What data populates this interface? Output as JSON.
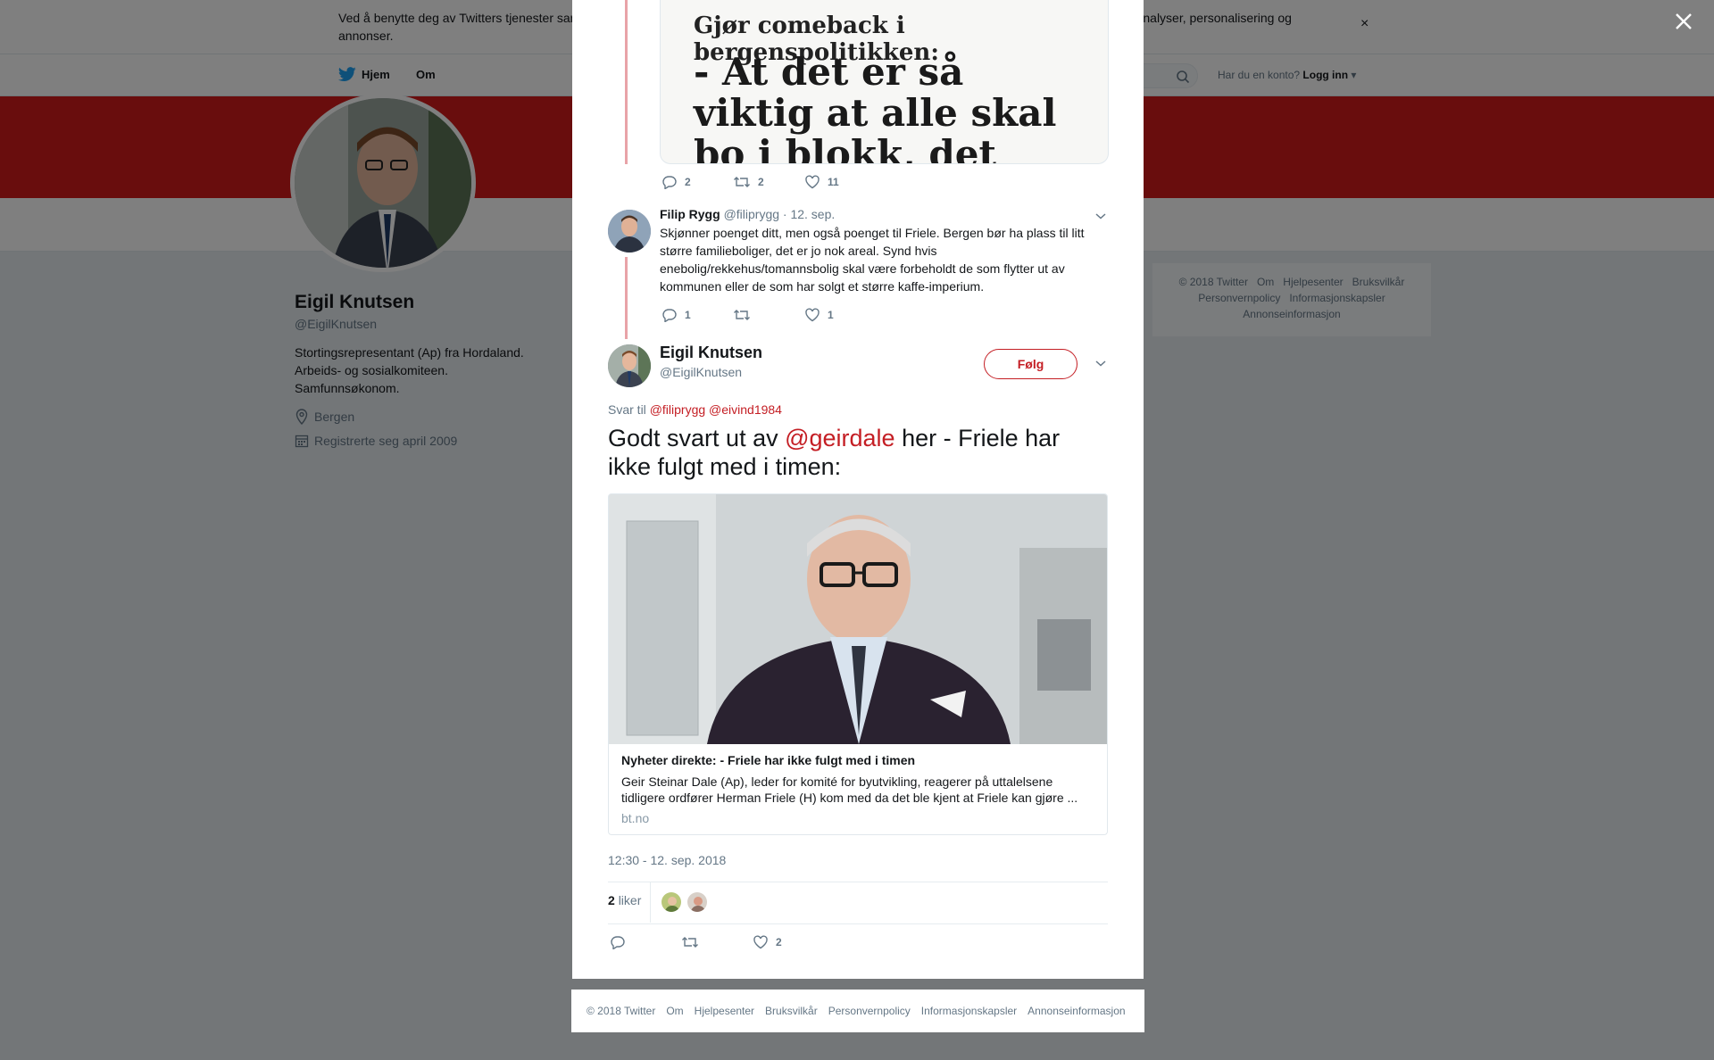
{
  "cookie_bar": {
    "text": "Ved å benytte deg av Twitters tjenester samtykker du i vår bruk av informasjonskapsler. Vi og våre partnere benytter informasjonskapsler til bl.a. analyser, personalisering og annonser.",
    "close_label": "×"
  },
  "topnav": {
    "home_label": "Hjem",
    "about_label": "Om",
    "login_prompt": "Har du en konto?",
    "login_label": "Logg inn"
  },
  "profile": {
    "name": "Eigil Knutsen",
    "handle": "@EigilKnutsen",
    "bio_lines": [
      "Stortingsrepresentant (Ap) fra Hordaland.",
      "Arbeids- og sosialkomiteen.",
      "Samfunnsøkonom."
    ],
    "location": "Bergen",
    "joined": "Registrerte seg april 2009"
  },
  "side_footer": {
    "links": [
      "© 2018 Twitter",
      "Om",
      "Hjelpesenter",
      "Bruksvilkår",
      "Personvernpolicy",
      "Informasjonskapsler",
      "Annonseinformasjon"
    ]
  },
  "thread": {
    "top_image": {
      "headline_small": "Gjør comeback i bergenspolitikken:",
      "headline_big": "- At det er så viktig at alle skal bo i blokk, det forstår jeg ikke"
    },
    "top_actions": {
      "replies": "2",
      "retweets": "2",
      "likes": "11"
    },
    "reply": {
      "name": "Filip Rygg",
      "handle": "@filiprygg",
      "date": "· 12. sep.",
      "text": "Skjønner poenget ditt, men også poenget til Friele. Bergen bør ha plass til litt større familieboliger, det er jo nok areal. Synd hvis enebolig/rekkehus/tomannsbolig skal være forbeholdt de som flytter ut av kommunen eller de som har solgt et større kaffe-imperium.",
      "replies": "1",
      "retweets": "",
      "likes": "1"
    }
  },
  "main_tweet": {
    "name": "Eigil Knutsen",
    "handle": "@EigilKnutsen",
    "follow_label": "Følg",
    "reply_to_prefix": "Svar til",
    "reply_to_1": "@filiprygg",
    "reply_to_2": "@eivind1984",
    "text_before": "Godt svart ut av ",
    "text_mention": "@geirdale",
    "text_after": " her - Friele har ikke fulgt med i timen:",
    "card": {
      "title": "Nyheter direkte: - Friele har ikke fulgt med i timen",
      "description": "Geir Steinar Dale (Ap), leder for komité for byutvikling, reagerer på uttalelsene tidligere ordfører Herman Friele (H) kom med da det ble kjent at Friele kan gjøre ...",
      "domain": "bt.no"
    },
    "timestamp": "12:30 - 12. sep. 2018",
    "likes_number": "2",
    "likes_label": "liker",
    "actions": {
      "replies": "",
      "retweets": "",
      "likes": "2"
    }
  },
  "bottom_footer": {
    "links": [
      "© 2018 Twitter",
      "Om",
      "Hjelpesenter",
      "Bruksvilkår",
      "Personvernpolicy",
      "Informasjonskapsler",
      "Annonseinformasjon"
    ]
  },
  "colors": {
    "accent": "#c41e24",
    "banner": "#d31a1a",
    "thread_line": "#e8a3a8",
    "secondary_text": "#657786"
  }
}
